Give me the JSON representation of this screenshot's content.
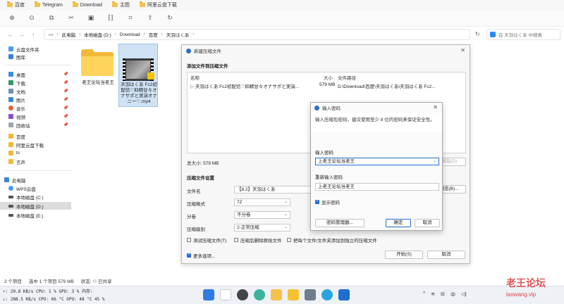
{
  "favorites": [
    "百度",
    "Telegram",
    "Download",
    "主图",
    "阿里云盘下载"
  ],
  "toolbar_icons": [
    "new-icon",
    "sort-icon",
    "copy-icon",
    "cut-icon",
    "paste-icon",
    "rename-icon",
    "crop-icon",
    "share-icon",
    "refresh-icon"
  ],
  "address": {
    "crumbs": [
      "此电脑",
      "本地磁盘 (D:)",
      "Download",
      "百度",
      "天羽はくあ"
    ],
    "search_placeholder": "在 天羽はくあ 中搜索"
  },
  "sidebar": {
    "top": [
      "云盘文件夹",
      "图库"
    ],
    "pinned": [
      "桌面",
      "下载",
      "文档",
      "图片",
      "音乐",
      "视频",
      "回收站"
    ],
    "folders": [
      "百度",
      "阿里云盘下载",
      "ts",
      "言声"
    ],
    "drives": [
      "此电脑",
      "WPS云盘",
      "本地磁盘 (C:)",
      "本地磁盘 (D:)",
      "本地磁盘 (E:)"
    ]
  },
  "files": [
    {
      "name": "老王论坛当老王"
    },
    {
      "name": "天羽はくあ Fc2初配信♡抑精甘々オナサポと実演オナニー♡.mp4"
    }
  ],
  "status": {
    "count": "2 个项目",
    "selected": "选中 1 个项目 579 MB",
    "state_label": "状态:",
    "state": "已共享"
  },
  "sysmon": {
    "line1": "↑: 20.8 KB/s   CPU: 1 %   GPU: 3 %   内存:",
    "line2": "↓: 288.5 KB/s  CPU: 66 °C  GPU: 48 °C  45 %"
  },
  "tray": {
    "ime": "中"
  },
  "watermark": {
    "title": "老王论坛",
    "url": "laowang.vip"
  },
  "archive_dialog": {
    "title": "新建压缩文件",
    "section_add": "添加文件到压缩文件",
    "headers": {
      "name": "名称",
      "size": "大小",
      "path": "文件路径"
    },
    "row": {
      "name": "天羽はくあ Fc2初配信♡抑精甘々オナサポと実演...",
      "size": "579 MB",
      "path": "D:\\Download\\百度\\天羽はくあ\\天羽はくあ Fc2..."
    },
    "total": "总大小: 579 MB",
    "delete_btn": "删除(D)",
    "section_settings": "压缩文件设置",
    "filename_label": "文件名",
    "filename_value": "【8.2】天羽はくあ",
    "browse_btn": "浏览(B)...",
    "format_label": "压缩格式",
    "format_value": "7Z",
    "split_label": "分卷",
    "split_value": "不分卷",
    "level_label": "压缩级别",
    "level_value": "2-正常压缩",
    "test_chk": "测试压缩文件(T)",
    "delete_chk": "压缩后删除原始文件",
    "separate_chk": "把每个文件/文件夹添加到独立的压缩文件",
    "more_chk": "更多选项...",
    "start_btn": "开始(S)",
    "cancel_btn": "取消"
  },
  "password_dialog": {
    "title": "输入密码",
    "info": "输入压缩包密码，建议使用至少 8 位的密码来保证安全性。",
    "pw_label": "输入密码",
    "pw_value": "上老王论坛当老王",
    "re_label": "重新输入密码",
    "re_value": "上老王论坛当老王",
    "show_chk": "显示密码",
    "manager_btn": "密码管理器...",
    "ok_btn": "确定",
    "cancel_btn": "取消"
  }
}
